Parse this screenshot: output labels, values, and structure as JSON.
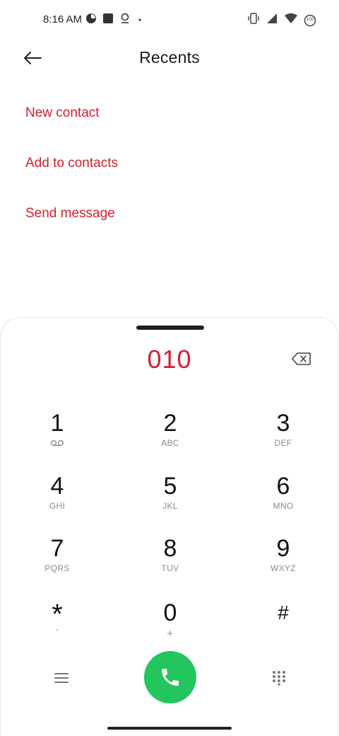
{
  "status_bar": {
    "time": "8:16 AM",
    "battery": "100",
    "icons_left": [
      "pie-clock-icon",
      "square-app-icon",
      "location-pin-icon",
      "dot-icon"
    ],
    "icons_right": [
      "vibrate-icon",
      "signal-icon",
      "wifi-icon",
      "battery-icon"
    ]
  },
  "header": {
    "title": "Recents",
    "back_icon": "back-arrow-icon"
  },
  "actions": [
    {
      "label": "New contact"
    },
    {
      "label": "Add to contacts"
    },
    {
      "label": "Send message"
    }
  ],
  "dialer": {
    "number": "010",
    "backspace_icon": "backspace-icon",
    "keys": [
      {
        "digit": "1",
        "letters": ""
      },
      {
        "digit": "2",
        "letters": "ABC"
      },
      {
        "digit": "3",
        "letters": "DEF"
      },
      {
        "digit": "4",
        "letters": "GHI"
      },
      {
        "digit": "5",
        "letters": "JKL"
      },
      {
        "digit": "6",
        "letters": "MNO"
      },
      {
        "digit": "7",
        "letters": "PQRS"
      },
      {
        "digit": "8",
        "letters": "TUV"
      },
      {
        "digit": "9",
        "letters": "WXYZ"
      },
      {
        "digit": "*",
        "letters": ","
      },
      {
        "digit": "0",
        "letters": "+"
      },
      {
        "digit": "#",
        "letters": ""
      }
    ],
    "bottom_icons": [
      "menu-icon",
      "call-icon",
      "keypad-icon"
    ],
    "accent_color": "#d11f2f",
    "call_color": "#22c55e"
  }
}
